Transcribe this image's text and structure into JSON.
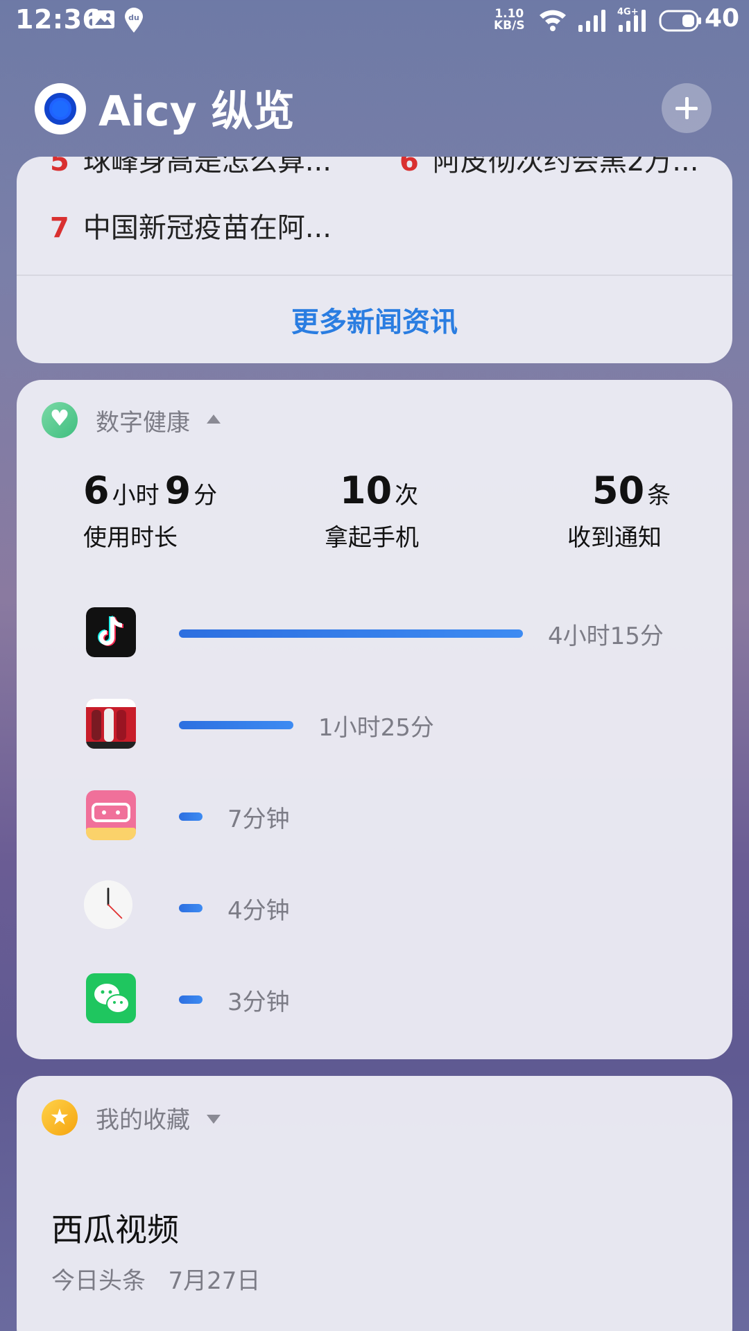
{
  "status_bar": {
    "time": "12:36",
    "net_speed_value": "1.10",
    "net_speed_unit": "KB/S",
    "network_type": "4G+",
    "battery": "40"
  },
  "header": {
    "title": "Aicy 纵览"
  },
  "news": {
    "partial_items": [
      {
        "num": "5",
        "text": "球峰身高是怎么算..."
      },
      {
        "num": "6",
        "text": "阿皮彻次约会黑2万..."
      }
    ],
    "items": [
      {
        "num": "7",
        "text": "中国新冠疫苗在阿..."
      }
    ],
    "more_label": "更多新闻资讯"
  },
  "health": {
    "title": "数字健康",
    "screen_time": {
      "hours": "6",
      "hours_unit": "小时",
      "minutes": "9",
      "minutes_unit": "分",
      "label": "使用时长"
    },
    "pickups": {
      "value": "10",
      "unit": "次",
      "label": "拿起手机"
    },
    "notifications": {
      "value": "50",
      "unit": "条",
      "label": "收到通知"
    },
    "apps": [
      {
        "icon": "tiktok-icon",
        "usage": "4小时15分",
        "fraction": 1.0
      },
      {
        "icon": "efootball-icon",
        "usage": "1小时25分",
        "fraction": 0.333
      },
      {
        "icon": "bilibili-icon",
        "usage": "7分钟",
        "fraction": 0.0275
      },
      {
        "icon": "clock-icon",
        "usage": "4分钟",
        "fraction": 0.0157
      },
      {
        "icon": "wechat-icon",
        "usage": "3分钟",
        "fraction": 0.0118
      }
    ],
    "colors": {
      "bar": "#2d6fe0"
    }
  },
  "favorites": {
    "title": "我的收藏",
    "item_title": "西瓜视频",
    "item_source": "今日头条",
    "item_date": "7月27日"
  }
}
